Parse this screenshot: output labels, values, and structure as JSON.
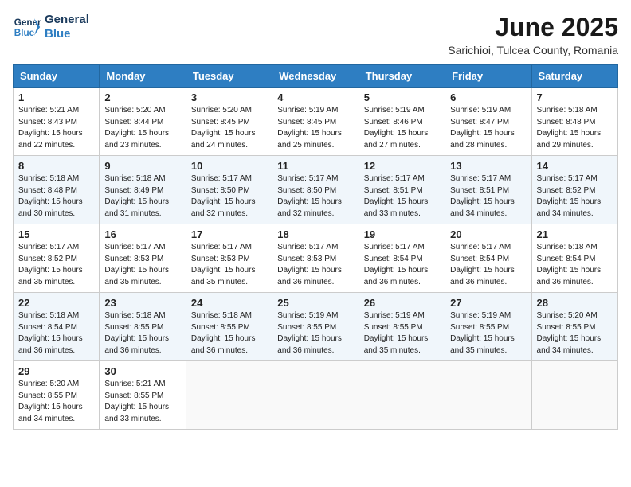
{
  "logo": {
    "line1": "General",
    "line2": "Blue"
  },
  "title": "June 2025",
  "location": "Sarichioi, Tulcea County, Romania",
  "weekdays": [
    "Sunday",
    "Monday",
    "Tuesday",
    "Wednesday",
    "Thursday",
    "Friday",
    "Saturday"
  ],
  "weeks": [
    [
      {
        "day": "1",
        "info": "Sunrise: 5:21 AM\nSunset: 8:43 PM\nDaylight: 15 hours\nand 22 minutes."
      },
      {
        "day": "2",
        "info": "Sunrise: 5:20 AM\nSunset: 8:44 PM\nDaylight: 15 hours\nand 23 minutes."
      },
      {
        "day": "3",
        "info": "Sunrise: 5:20 AM\nSunset: 8:45 PM\nDaylight: 15 hours\nand 24 minutes."
      },
      {
        "day": "4",
        "info": "Sunrise: 5:19 AM\nSunset: 8:45 PM\nDaylight: 15 hours\nand 25 minutes."
      },
      {
        "day": "5",
        "info": "Sunrise: 5:19 AM\nSunset: 8:46 PM\nDaylight: 15 hours\nand 27 minutes."
      },
      {
        "day": "6",
        "info": "Sunrise: 5:19 AM\nSunset: 8:47 PM\nDaylight: 15 hours\nand 28 minutes."
      },
      {
        "day": "7",
        "info": "Sunrise: 5:18 AM\nSunset: 8:48 PM\nDaylight: 15 hours\nand 29 minutes."
      }
    ],
    [
      {
        "day": "8",
        "info": "Sunrise: 5:18 AM\nSunset: 8:48 PM\nDaylight: 15 hours\nand 30 minutes."
      },
      {
        "day": "9",
        "info": "Sunrise: 5:18 AM\nSunset: 8:49 PM\nDaylight: 15 hours\nand 31 minutes."
      },
      {
        "day": "10",
        "info": "Sunrise: 5:17 AM\nSunset: 8:50 PM\nDaylight: 15 hours\nand 32 minutes."
      },
      {
        "day": "11",
        "info": "Sunrise: 5:17 AM\nSunset: 8:50 PM\nDaylight: 15 hours\nand 32 minutes."
      },
      {
        "day": "12",
        "info": "Sunrise: 5:17 AM\nSunset: 8:51 PM\nDaylight: 15 hours\nand 33 minutes."
      },
      {
        "day": "13",
        "info": "Sunrise: 5:17 AM\nSunset: 8:51 PM\nDaylight: 15 hours\nand 34 minutes."
      },
      {
        "day": "14",
        "info": "Sunrise: 5:17 AM\nSunset: 8:52 PM\nDaylight: 15 hours\nand 34 minutes."
      }
    ],
    [
      {
        "day": "15",
        "info": "Sunrise: 5:17 AM\nSunset: 8:52 PM\nDaylight: 15 hours\nand 35 minutes."
      },
      {
        "day": "16",
        "info": "Sunrise: 5:17 AM\nSunset: 8:53 PM\nDaylight: 15 hours\nand 35 minutes."
      },
      {
        "day": "17",
        "info": "Sunrise: 5:17 AM\nSunset: 8:53 PM\nDaylight: 15 hours\nand 35 minutes."
      },
      {
        "day": "18",
        "info": "Sunrise: 5:17 AM\nSunset: 8:53 PM\nDaylight: 15 hours\nand 36 minutes."
      },
      {
        "day": "19",
        "info": "Sunrise: 5:17 AM\nSunset: 8:54 PM\nDaylight: 15 hours\nand 36 minutes."
      },
      {
        "day": "20",
        "info": "Sunrise: 5:17 AM\nSunset: 8:54 PM\nDaylight: 15 hours\nand 36 minutes."
      },
      {
        "day": "21",
        "info": "Sunrise: 5:18 AM\nSunset: 8:54 PM\nDaylight: 15 hours\nand 36 minutes."
      }
    ],
    [
      {
        "day": "22",
        "info": "Sunrise: 5:18 AM\nSunset: 8:54 PM\nDaylight: 15 hours\nand 36 minutes."
      },
      {
        "day": "23",
        "info": "Sunrise: 5:18 AM\nSunset: 8:55 PM\nDaylight: 15 hours\nand 36 minutes."
      },
      {
        "day": "24",
        "info": "Sunrise: 5:18 AM\nSunset: 8:55 PM\nDaylight: 15 hours\nand 36 minutes."
      },
      {
        "day": "25",
        "info": "Sunrise: 5:19 AM\nSunset: 8:55 PM\nDaylight: 15 hours\nand 36 minutes."
      },
      {
        "day": "26",
        "info": "Sunrise: 5:19 AM\nSunset: 8:55 PM\nDaylight: 15 hours\nand 35 minutes."
      },
      {
        "day": "27",
        "info": "Sunrise: 5:19 AM\nSunset: 8:55 PM\nDaylight: 15 hours\nand 35 minutes."
      },
      {
        "day": "28",
        "info": "Sunrise: 5:20 AM\nSunset: 8:55 PM\nDaylight: 15 hours\nand 34 minutes."
      }
    ],
    [
      {
        "day": "29",
        "info": "Sunrise: 5:20 AM\nSunset: 8:55 PM\nDaylight: 15 hours\nand 34 minutes."
      },
      {
        "day": "30",
        "info": "Sunrise: 5:21 AM\nSunset: 8:55 PM\nDaylight: 15 hours\nand 33 minutes."
      },
      {
        "day": "",
        "info": ""
      },
      {
        "day": "",
        "info": ""
      },
      {
        "day": "",
        "info": ""
      },
      {
        "day": "",
        "info": ""
      },
      {
        "day": "",
        "info": ""
      }
    ]
  ]
}
